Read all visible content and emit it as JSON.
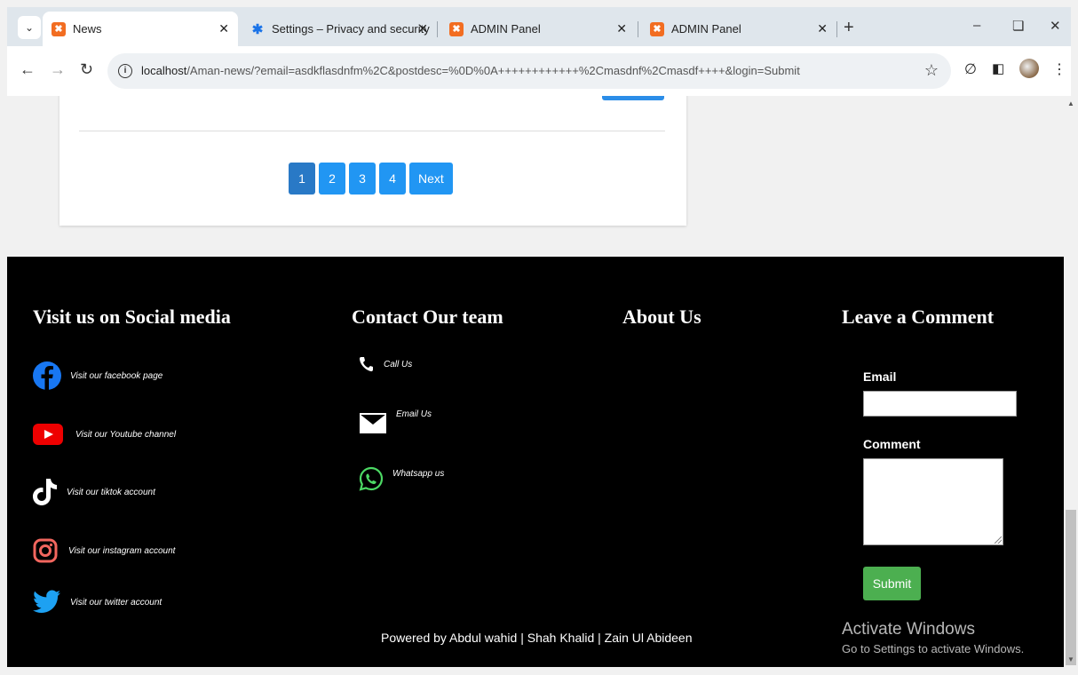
{
  "browser": {
    "tabs": [
      {
        "title": "News",
        "favicon": "xampp-icon",
        "active": true
      },
      {
        "title": "Settings – Privacy and security",
        "favicon": "settings-gear-icon",
        "active": false
      },
      {
        "title": "ADMIN Panel",
        "favicon": "xampp-icon",
        "active": false
      },
      {
        "title": "ADMIN Panel",
        "favicon": "xampp-icon",
        "active": false
      }
    ],
    "url_host": "localhost",
    "url_rest": "/Aman-news/?email=asdkflasdnfm%2C&postdesc=%0D%0A++++++++++++%2Cmasdnf%2Cmasdf++++&login=Submit"
  },
  "pagination": {
    "pages": [
      "1",
      "2",
      "3",
      "4"
    ],
    "next": "Next",
    "current": "1"
  },
  "footer": {
    "social": {
      "heading": "Visit us on Social media",
      "items": [
        {
          "label": "Visit our facebook page",
          "icon": "facebook-icon"
        },
        {
          "label": "Visit our Youtube channel",
          "icon": "youtube-icon"
        },
        {
          "label": "Visit our tiktok account",
          "icon": "tiktok-icon"
        },
        {
          "label": "Visit our instagram account",
          "icon": "instagram-icon"
        },
        {
          "label": "Visit our twitter account",
          "icon": "twitter-icon"
        }
      ]
    },
    "contact": {
      "heading": "Contact Our team",
      "items": [
        {
          "label": "Call Us",
          "icon": "phone-icon"
        },
        {
          "label": "Email Us",
          "icon": "envelope-icon"
        },
        {
          "label": "Whatsapp us",
          "icon": "whatsapp-icon"
        }
      ]
    },
    "about": {
      "heading": "About Us"
    },
    "comment": {
      "heading": "Leave a Comment",
      "email_label": "Email",
      "comment_label": "Comment",
      "submit": "Submit"
    },
    "powered": "Powered by Abdul wahid  | Shah Khalid  | Zain Ul Abideen"
  },
  "watermark": {
    "line1": "Activate Windows",
    "line2": "Go to Settings to activate Windows."
  },
  "colors": {
    "pager_blue": "#2196f3",
    "submit_green": "#4caf50",
    "footer_bg": "#000000"
  }
}
